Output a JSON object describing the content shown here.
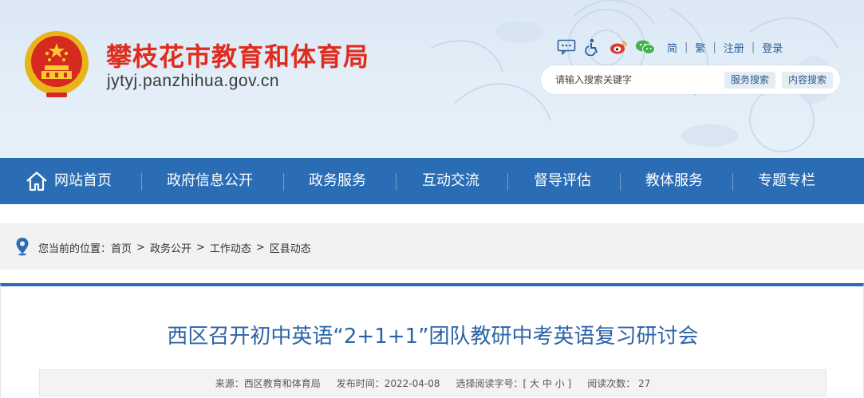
{
  "header": {
    "site_title": "攀枝花市教育和体育局",
    "site_domain": "jytyj.panzhihua.gov.cn",
    "toolbar": {
      "icons": [
        "message-icon",
        "accessibility-icon",
        "weibo-icon",
        "wechat-icon"
      ],
      "lang_simplified": "简",
      "lang_traditional": "繁",
      "register": "注册",
      "login": "登录",
      "separator": "|"
    },
    "search": {
      "placeholder": "请输入搜索关键字",
      "service_search": "服务搜索",
      "content_search": "内容搜索"
    }
  },
  "nav": {
    "items": [
      {
        "label": "网站首页",
        "icon": "home-icon"
      },
      {
        "label": "政府信息公开"
      },
      {
        "label": "政务服务"
      },
      {
        "label": "互动交流"
      },
      {
        "label": "督导评估"
      },
      {
        "label": "教体服务"
      },
      {
        "label": "专题专栏"
      }
    ]
  },
  "breadcrumb": {
    "icon": "location-pin-icon",
    "prefix": "您当前的位置：",
    "items": [
      "首页",
      "政务公开",
      "工作动态",
      "区县动态"
    ],
    "arrow": ">"
  },
  "article": {
    "title": "西区召开初中英语“2+1+1”团队教研中考英语复习研讨会",
    "meta": {
      "source": "来源：西区教育和体育局",
      "published": "发布时间：2022-04-08",
      "font_size_label": "选择阅读字号：[",
      "size_large": "大",
      "size_medium": "中",
      "size_small": "小",
      "font_size_close": "]",
      "views": "阅读次数： 27"
    }
  },
  "colors": {
    "nav_blue": "#2a6db5",
    "title_red": "#e02c1e",
    "article_title_blue": "#2b63a8",
    "header_bg": "#dfebf6"
  }
}
